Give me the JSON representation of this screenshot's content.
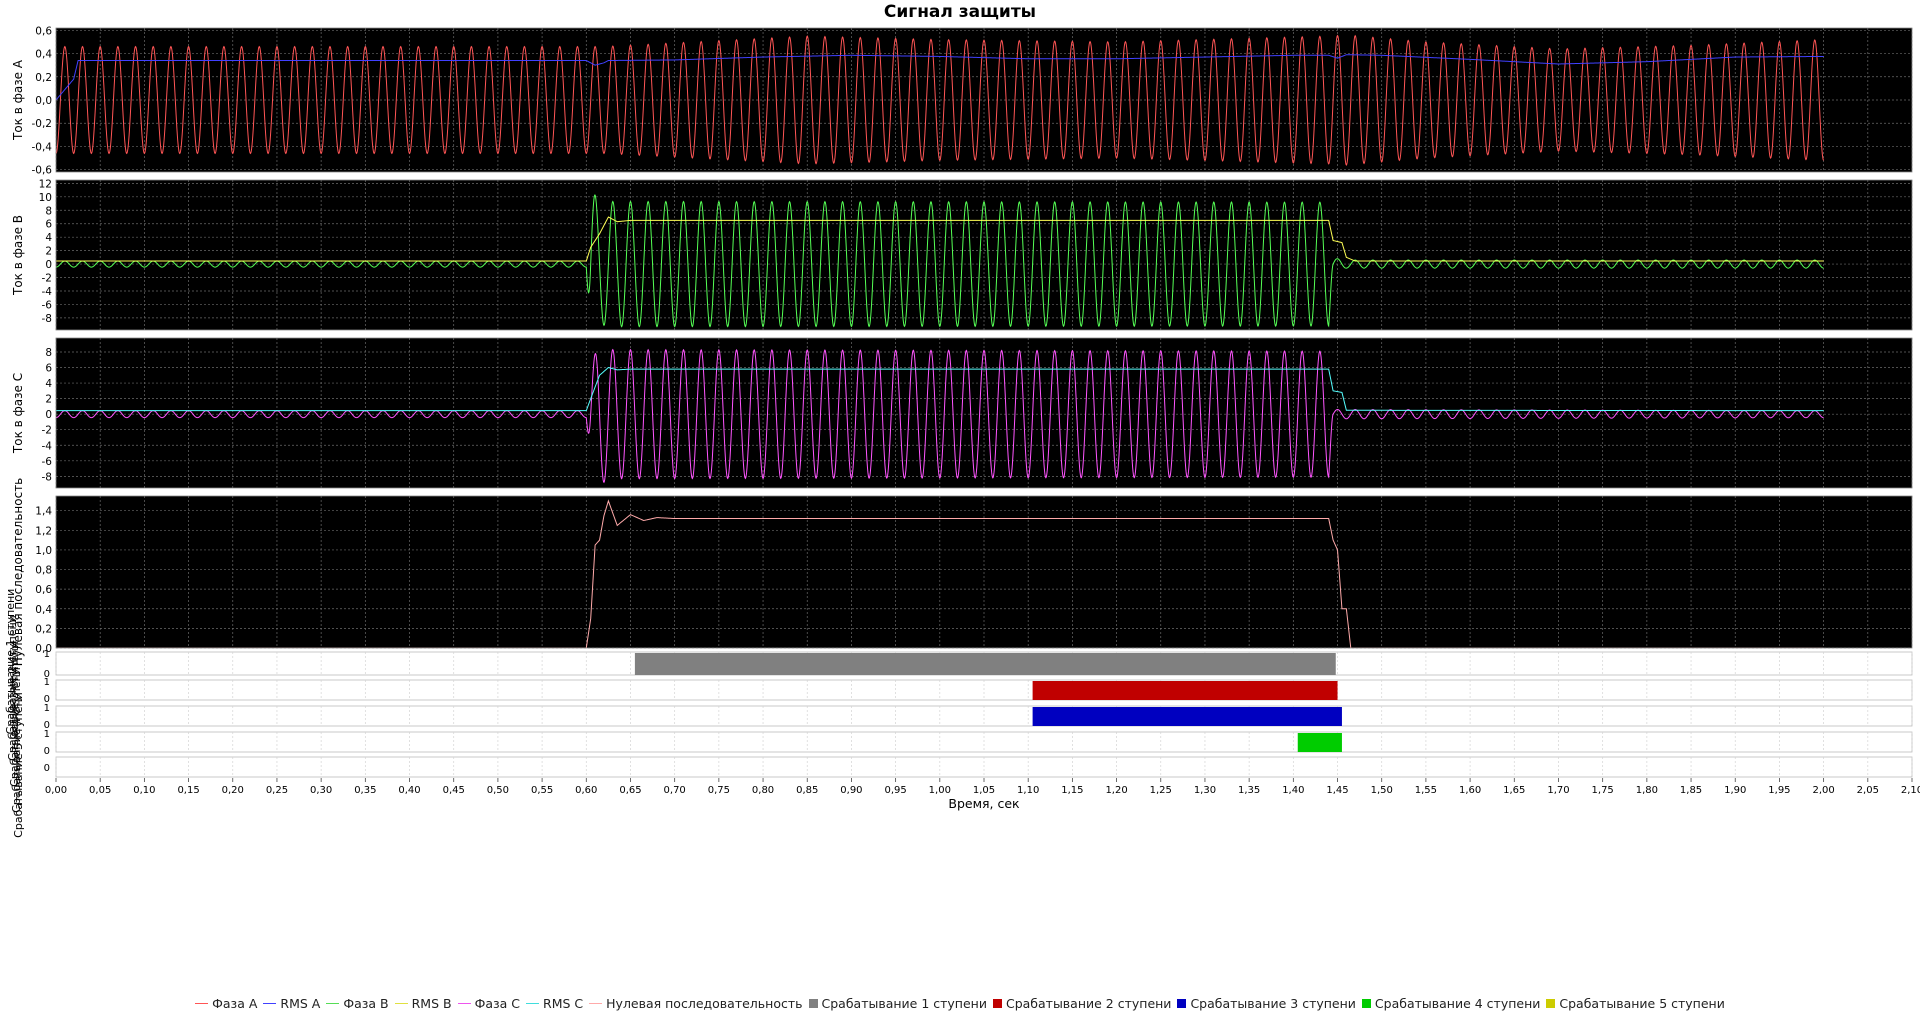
{
  "chart_data": {
    "type": "line",
    "title": "Сигнал защиты",
    "xlabel": "Время, сек",
    "xlim": [
      0,
      2.1
    ],
    "xticks": [
      "0,00",
      "0,05",
      "0,10",
      "0,15",
      "0,20",
      "0,25",
      "0,30",
      "0,35",
      "0,40",
      "0,45",
      "0,50",
      "0,55",
      "0,60",
      "0,65",
      "0,70",
      "0,75",
      "0,80",
      "0,85",
      "0,90",
      "0,95",
      "1,00",
      "1,05",
      "1,10",
      "1,15",
      "1,20",
      "1,25",
      "1,30",
      "1,35",
      "1,40",
      "1,45",
      "1,50",
      "1,55",
      "1,60",
      "1,65",
      "1,70",
      "1,75",
      "1,80",
      "1,85",
      "1,90",
      "1,95",
      "2,00",
      "2,05",
      "2,10"
    ],
    "frequency_hz": 50,
    "grid": true,
    "legend_position": "bottom",
    "panels": [
      {
        "ylabel": "Ток в фазе A",
        "ylim": [
          -0.62,
          0.62
        ],
        "yticks": [
          "-0,6",
          "-0,4",
          "-0,2",
          "0,0",
          "0,2",
          "0,4",
          "0,6"
        ],
        "series": [
          {
            "name": "Фаза A",
            "color": "#ff5555",
            "kind": "sine",
            "amplitude": [
              [
                0,
                0.46
              ],
              [
                0.6,
                0.46
              ],
              [
                0.62,
                0.46
              ],
              [
                0.85,
                0.55
              ],
              [
                1.0,
                0.52
              ],
              [
                1.2,
                0.5
              ],
              [
                1.44,
                0.55
              ],
              [
                1.46,
                0.56
              ],
              [
                1.55,
                0.5
              ],
              [
                1.7,
                0.44
              ],
              [
                1.85,
                0.47
              ],
              [
                2.0,
                0.52
              ]
            ]
          },
          {
            "name": "RMS A",
            "color": "#4040ff",
            "kind": "envelope",
            "points": [
              [
                0,
                0
              ],
              [
                0.02,
                0.18
              ],
              [
                0.025,
                0.34
              ],
              [
                0.6,
                0.34
              ],
              [
                0.61,
                0.3
              ],
              [
                0.62,
                0.32
              ],
              [
                0.625,
                0.34
              ],
              [
                0.7,
                0.345
              ],
              [
                0.8,
                0.37
              ],
              [
                0.9,
                0.385
              ],
              [
                1.0,
                0.375
              ],
              [
                1.1,
                0.355
              ],
              [
                1.2,
                0.355
              ],
              [
                1.3,
                0.37
              ],
              [
                1.4,
                0.385
              ],
              [
                1.44,
                0.385
              ],
              [
                1.45,
                0.36
              ],
              [
                1.46,
                0.39
              ],
              [
                1.5,
                0.385
              ],
              [
                1.6,
                0.35
              ],
              [
                1.7,
                0.31
              ],
              [
                1.8,
                0.33
              ],
              [
                1.9,
                0.37
              ],
              [
                2.0,
                0.375
              ]
            ]
          }
        ]
      },
      {
        "ylabel": "Ток в фазе B",
        "ylim": [
          -9.8,
          12.5
        ],
        "yticks": [
          "-8",
          "-6",
          "-4",
          "-2",
          "0",
          "2",
          "4",
          "6",
          "8",
          "10",
          "12"
        ],
        "series": [
          {
            "name": "Фаза B",
            "color": "#55ff55",
            "kind": "sine",
            "amplitude": [
              [
                0,
                0.45
              ],
              [
                0.6,
                0.45
              ],
              [
                0.605,
                11.5
              ],
              [
                0.615,
                9
              ],
              [
                0.63,
                9.3
              ],
              [
                1.44,
                9.2
              ],
              [
                1.445,
                0.9
              ],
              [
                1.46,
                0.6
              ],
              [
                2.0,
                0.6
              ]
            ]
          },
          {
            "name": "RMS B",
            "color": "#ffff55",
            "kind": "envelope",
            "points": [
              [
                0,
                0.45
              ],
              [
                0.6,
                0.45
              ],
              [
                0.605,
                2.5
              ],
              [
                0.615,
                4.5
              ],
              [
                0.625,
                7
              ],
              [
                0.635,
                6.3
              ],
              [
                0.65,
                6.5
              ],
              [
                1.44,
                6.5
              ],
              [
                1.445,
                3.5
              ],
              [
                1.455,
                3.2
              ],
              [
                1.46,
                1.0
              ],
              [
                1.47,
                0.45
              ],
              [
                2.0,
                0.45
              ]
            ]
          }
        ]
      },
      {
        "ylabel": "Ток в фазе C",
        "ylim": [
          -9.5,
          9.8
        ],
        "yticks": [
          "-8",
          "-6",
          "-4",
          "-2",
          "0",
          "2",
          "4",
          "6",
          "8"
        ],
        "series": [
          {
            "name": "Фаза C",
            "color": "#ff55ff",
            "kind": "sine",
            "amplitude": [
              [
                0,
                0.45
              ],
              [
                0.6,
                0.45
              ],
              [
                0.605,
                6.5
              ],
              [
                0.615,
                9
              ],
              [
                0.63,
                8.3
              ],
              [
                1.44,
                8.1
              ],
              [
                1.445,
                0.6
              ],
              [
                2.0,
                0.45
              ]
            ]
          },
          {
            "name": "RMS C",
            "color": "#55ffff",
            "kind": "envelope",
            "points": [
              [
                0,
                0.45
              ],
              [
                0.6,
                0.45
              ],
              [
                0.605,
                2
              ],
              [
                0.615,
                5
              ],
              [
                0.625,
                6
              ],
              [
                0.635,
                5.7
              ],
              [
                0.65,
                5.8
              ],
              [
                1.44,
                5.8
              ],
              [
                1.445,
                3
              ],
              [
                1.455,
                2.8
              ],
              [
                1.46,
                0.5
              ],
              [
                2.0,
                0.45
              ]
            ]
          }
        ]
      },
      {
        "ylabel": "Нулевая последовательность",
        "ylim": [
          0,
          1.55
        ],
        "yticks": [
          "0,0",
          "0,2",
          "0,4",
          "0,6",
          "0,8",
          "1,0",
          "1,2",
          "1,4"
        ],
        "series": [
          {
            "name": "Нулевая последовательность",
            "color": "#ffaaaa",
            "kind": "envelope",
            "points": [
              [
                0,
                0
              ],
              [
                0.6,
                0
              ],
              [
                0.605,
                0.3
              ],
              [
                0.61,
                1.05
              ],
              [
                0.615,
                1.1
              ],
              [
                0.62,
                1.35
              ],
              [
                0.625,
                1.5
              ],
              [
                0.635,
                1.25
              ],
              [
                0.65,
                1.36
              ],
              [
                0.665,
                1.3
              ],
              [
                0.68,
                1.33
              ],
              [
                0.7,
                1.32
              ],
              [
                1.44,
                1.32
              ],
              [
                1.445,
                1.1
              ],
              [
                1.45,
                1.0
              ],
              [
                1.455,
                0.4
              ],
              [
                1.46,
                0.4
              ],
              [
                1.465,
                0.0
              ],
              [
                2.0,
                0
              ]
            ]
          }
        ]
      }
    ],
    "step_panels": [
      {
        "ylabel": "Срабатывание 1 ступени",
        "yticks": [
          "0",
          "1"
        ],
        "color": "#808080",
        "on": [
          0.655,
          1.448
        ]
      },
      {
        "ylabel": "Срабатывание 2 ступени",
        "yticks": [
          "0",
          "1"
        ],
        "color": "#c00000",
        "on": [
          1.105,
          1.45
        ]
      },
      {
        "ylabel": "Срабатывание 3 ступени",
        "yticks": [
          "0",
          "1"
        ],
        "color": "#0000c0",
        "on": [
          1.105,
          1.455
        ]
      },
      {
        "ylabel": "Срабатывание 4 ступени",
        "yticks": [
          "0",
          "1"
        ],
        "color": "#00cc00",
        "on": [
          1.405,
          1.455
        ]
      },
      {
        "ylabel": "Срабатывание 5 ступени",
        "yticks": [
          "0"
        ],
        "color": "#cccc00",
        "on": null
      }
    ],
    "legend": [
      {
        "label": "Фаза A",
        "color": "#ff5555",
        "kind": "line"
      },
      {
        "label": "RMS A",
        "color": "#4040ff",
        "kind": "line"
      },
      {
        "label": "Фаза B",
        "color": "#55dd55",
        "kind": "line"
      },
      {
        "label": "RMS B",
        "color": "#e0e040",
        "kind": "line"
      },
      {
        "label": "Фаза C",
        "color": "#ee55ee",
        "kind": "line"
      },
      {
        "label": "RMS C",
        "color": "#40dddd",
        "kind": "line"
      },
      {
        "label": "Нулевая последовательность",
        "color": "#ffaaaa",
        "kind": "line"
      },
      {
        "label": "Срабатывание 1 ступени",
        "color": "#808080",
        "kind": "box"
      },
      {
        "label": "Срабатывание 2 ступени",
        "color": "#c00000",
        "kind": "box"
      },
      {
        "label": "Срабатывание 3 ступени",
        "color": "#0000c0",
        "kind": "box"
      },
      {
        "label": "Срабатывание 4 ступени",
        "color": "#00cc00",
        "kind": "box"
      },
      {
        "label": "Срабатывание 5 ступени",
        "color": "#cccc00",
        "kind": "box"
      }
    ]
  }
}
